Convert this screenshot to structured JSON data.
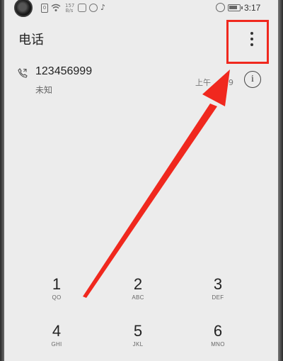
{
  "status_bar": {
    "sim_label": "0",
    "speed_label": "157 B/s",
    "time": "3:17"
  },
  "app": {
    "title": "电话"
  },
  "call_log": [
    {
      "number": "123456999",
      "status": "未知",
      "time": "上午 … 29",
      "info_label": "i"
    }
  ],
  "keypad": [
    {
      "digit": "1",
      "letters": "QO"
    },
    {
      "digit": "2",
      "letters": "ABC"
    },
    {
      "digit": "3",
      "letters": "DEF"
    },
    {
      "digit": "4",
      "letters": "GHI"
    },
    {
      "digit": "5",
      "letters": "JKL"
    },
    {
      "digit": "6",
      "letters": "MNO"
    }
  ],
  "annotation": {
    "highlight_color": "#f0281e",
    "arrow_color": "#f0281e"
  }
}
